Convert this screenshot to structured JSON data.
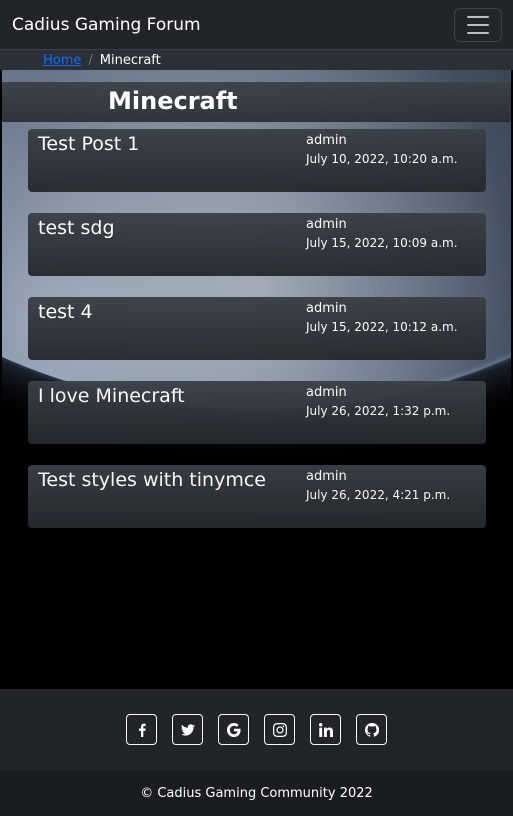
{
  "navbar": {
    "brand": "Cadius Gaming Forum",
    "toggler_icon": "hamburger-menu-icon"
  },
  "breadcrumb": {
    "home": "Home",
    "separator": "/",
    "current": "Minecraft"
  },
  "page": {
    "title": "Minecraft"
  },
  "posts": [
    {
      "title": "Test Post 1",
      "author": "admin",
      "date": "July 10, 2022, 10:20 a.m."
    },
    {
      "title": "test sdg",
      "author": "admin",
      "date": "July 15, 2022, 10:09 a.m."
    },
    {
      "title": "test 4",
      "author": "admin",
      "date": "July 15, 2022, 10:12 a.m."
    },
    {
      "title": "I love Minecraft",
      "author": "admin",
      "date": "July 26, 2022, 1:32 p.m."
    },
    {
      "title": "Test styles with tinymce",
      "author": "admin",
      "date": "July 26, 2022, 4:21 p.m."
    }
  ],
  "footer": {
    "social_icons": [
      "facebook-icon",
      "twitter-icon",
      "google-icon",
      "instagram-icon",
      "linkedin-icon",
      "github-icon"
    ],
    "copyright": "© Cadius Gaming Community 2022"
  },
  "colors": {
    "navbar_bg": "#212529",
    "link": "#0d6efd",
    "background": "#000000"
  }
}
